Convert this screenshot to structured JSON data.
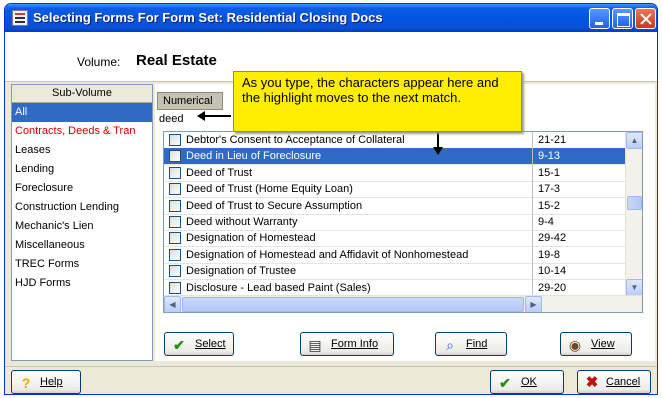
{
  "window": {
    "title": "Selecting Forms For Form Set: Residential Closing Docs",
    "title_icon": "form-set-icon"
  },
  "volume": {
    "label": "Volume:",
    "value": "Real Estate"
  },
  "subvolume": {
    "header": "Sub-Volume",
    "items": [
      {
        "label": "All",
        "selected": true
      },
      {
        "label": "Contracts, Deeds & Tran",
        "highlight": true
      },
      {
        "label": "Leases"
      },
      {
        "label": "Lending"
      },
      {
        "label": "Foreclosure"
      },
      {
        "label": "Construction Lending"
      },
      {
        "label": "Mechanic's Lien"
      },
      {
        "label": "Miscellaneous"
      },
      {
        "label": "TREC Forms"
      },
      {
        "label": "HJD Forms"
      }
    ]
  },
  "sort": {
    "tab_label": "Numerical"
  },
  "search": {
    "value": "deed"
  },
  "callout": {
    "text": "As you type, the characters appear here and the highlight moves to the next match.",
    "color": "#ffee00"
  },
  "forms": [
    {
      "name": "Debtor's Consent to Acceptance of Collateral",
      "code": "21-21",
      "selected": false
    },
    {
      "name": "Deed in Lieu of Foreclosure",
      "code": "9-13",
      "selected": true
    },
    {
      "name": "Deed of Trust",
      "code": "15-1",
      "selected": false
    },
    {
      "name": "Deed of Trust (Home Equity Loan)",
      "code": "17-3",
      "selected": false
    },
    {
      "name": "Deed of Trust to Secure Assumption",
      "code": "15-2",
      "selected": false
    },
    {
      "name": "Deed without Warranty",
      "code": "9-4",
      "selected": false
    },
    {
      "name": "Designation of Homestead",
      "code": "29-42",
      "selected": false
    },
    {
      "name": "Designation of Homestead and Affidavit of Nonhomestead",
      "code": "19-8",
      "selected": false
    },
    {
      "name": "Designation of Trustee",
      "code": "10-14",
      "selected": false
    },
    {
      "name": "Disclosure - Lead based Paint (Sales)",
      "code": "29-20",
      "selected": false
    }
  ],
  "actions": {
    "select": "Select",
    "form_info": "Form Info",
    "find": "Find",
    "view": "View"
  },
  "footer": {
    "help": "Help",
    "ok": "OK",
    "cancel": "Cancel"
  },
  "colors": {
    "selection": "#316ac5",
    "title_bar": "#0054e3",
    "subvolume_highlight": "#d00000"
  }
}
